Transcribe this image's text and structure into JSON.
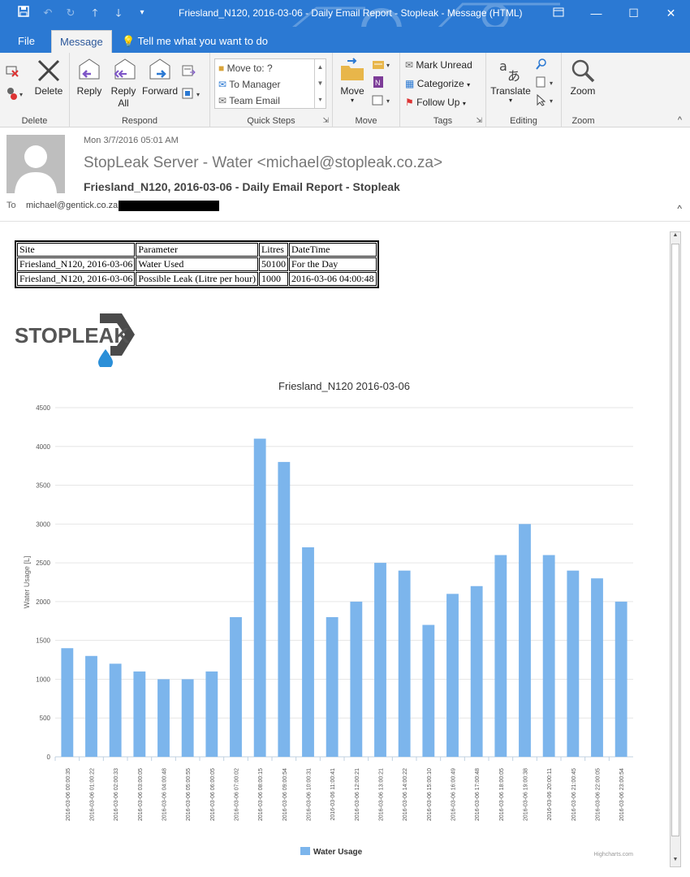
{
  "window": {
    "title": "Friesland_N120, 2016-03-06 - Daily Email Report - Stopleak - Message (HTML)"
  },
  "tabs": [
    "File",
    "Message",
    "Tell me what you want to do"
  ],
  "ribbon": {
    "delete_group": {
      "label": "Delete",
      "delete_button": "Delete"
    },
    "respond_group": {
      "label": "Respond",
      "reply": "Reply",
      "reply_all_1": "Reply",
      "reply_all_2": "All",
      "forward": "Forward"
    },
    "quick_steps": {
      "label": "Quick Steps",
      "items": [
        "Move to: ?",
        "To Manager",
        "Team Email"
      ]
    },
    "move_group": {
      "label": "Move",
      "move_button": "Move"
    },
    "tags_group": {
      "label": "Tags",
      "mark_unread": "Mark Unread",
      "categorize": "Categorize",
      "follow_up": "Follow Up"
    },
    "editing_group": {
      "label": "Editing",
      "translate": "Translate"
    },
    "zoom_group": {
      "label": "Zoom",
      "zoom": "Zoom"
    }
  },
  "message": {
    "date": "Mon 3/7/2016 05:01 AM",
    "sender": "StopLeak Server - Water <michael@stopleak.co.za>",
    "subject": "Friesland_N120, 2016-03-06 - Daily Email Report - Stopleak",
    "to_label": "To",
    "to_value": "michael@gentick.co.za;"
  },
  "report_table": {
    "headers": [
      "Site",
      "Parameter",
      "Litres",
      "DateTime"
    ],
    "rows": [
      [
        "Friesland_N120, 2016-03-06",
        "Water Used",
        "50100",
        "For the Day"
      ],
      [
        "Friesland_N120, 2016-03-06",
        "Possible Leak (Litre per hour)",
        "1000",
        "2016-03-06 04:00:48"
      ]
    ]
  },
  "logo": {
    "text": "STOPLEAK"
  },
  "colors": {
    "accent": "#2b79d3",
    "bar": "#7cb5ec",
    "ribbon_bg": "#f3f3f3"
  },
  "chart_data": {
    "type": "bar",
    "title": "Friesland_N120 2016-03-06",
    "xlabel": "",
    "ylabel": "Water Usage [L]",
    "ylim": [
      0,
      4500
    ],
    "yticks": [
      0,
      500,
      1000,
      1500,
      2000,
      2500,
      3000,
      3500,
      4000,
      4500
    ],
    "grid": true,
    "legend": "bottom-center",
    "credit": "Highcharts.com",
    "categories": [
      "2016-03-06 00:00:35",
      "2016-03-06 01:00:22",
      "2016-03-06 02:00:33",
      "2016-03-06 03:00:05",
      "2016-03-06 04:00:48",
      "2016-03-06 05:00:55",
      "2016-03-06 06:00:05",
      "2016-03-06 07:00:02",
      "2016-03-06 08:00:15",
      "2016-03-06 09:00:54",
      "2016-03-06 10:00:31",
      "2016-03-06 11:00:41",
      "2016-03-06 12:00:21",
      "2016-03-06 13:00:21",
      "2016-03-06 14:00:22",
      "2016-03-06 15:00:10",
      "2016-03-06 16:00:49",
      "2016-03-06 17:00:48",
      "2016-03-06 18:00:05",
      "2016-03-06 19:00:38",
      "2016-03-06 20:00:11",
      "2016-03-06 21:00:45",
      "2016-03-06 22:00:05",
      "2016-03-06 23:00:54"
    ],
    "series": [
      {
        "name": "Water Usage",
        "color": "#7cb5ec",
        "values": [
          1400,
          1300,
          1200,
          1100,
          1000,
          1000,
          1100,
          1800,
          4100,
          3800,
          2700,
          1800,
          2000,
          2500,
          2400,
          1700,
          2100,
          2200,
          2600,
          3000,
          2600,
          2400,
          2300,
          2000
        ]
      }
    ]
  }
}
